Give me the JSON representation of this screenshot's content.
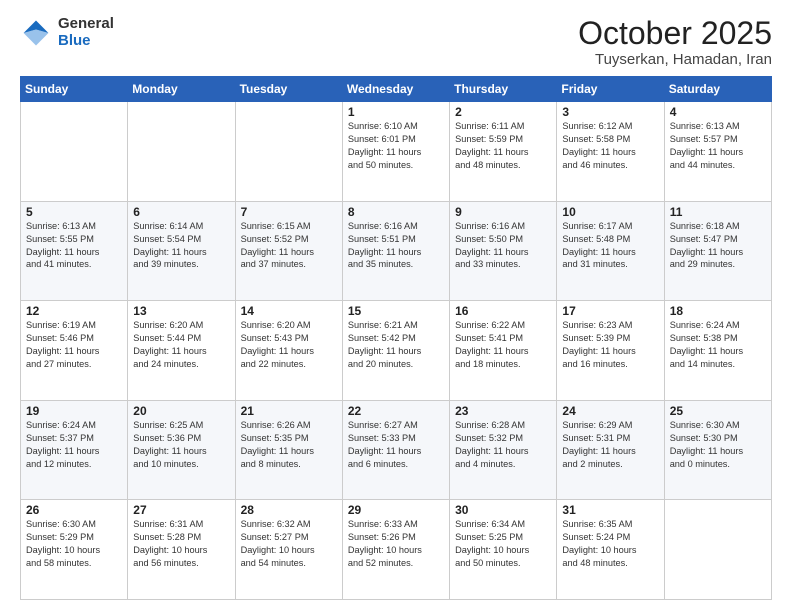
{
  "logo": {
    "general": "General",
    "blue": "Blue"
  },
  "header": {
    "month": "October 2025",
    "location": "Tuyserkan, Hamadan, Iran"
  },
  "weekdays": [
    "Sunday",
    "Monday",
    "Tuesday",
    "Wednesday",
    "Thursday",
    "Friday",
    "Saturday"
  ],
  "weeks": [
    [
      {
        "day": "",
        "info": ""
      },
      {
        "day": "",
        "info": ""
      },
      {
        "day": "",
        "info": ""
      },
      {
        "day": "1",
        "info": "Sunrise: 6:10 AM\nSunset: 6:01 PM\nDaylight: 11 hours\nand 50 minutes."
      },
      {
        "day": "2",
        "info": "Sunrise: 6:11 AM\nSunset: 5:59 PM\nDaylight: 11 hours\nand 48 minutes."
      },
      {
        "day": "3",
        "info": "Sunrise: 6:12 AM\nSunset: 5:58 PM\nDaylight: 11 hours\nand 46 minutes."
      },
      {
        "day": "4",
        "info": "Sunrise: 6:13 AM\nSunset: 5:57 PM\nDaylight: 11 hours\nand 44 minutes."
      }
    ],
    [
      {
        "day": "5",
        "info": "Sunrise: 6:13 AM\nSunset: 5:55 PM\nDaylight: 11 hours\nand 41 minutes."
      },
      {
        "day": "6",
        "info": "Sunrise: 6:14 AM\nSunset: 5:54 PM\nDaylight: 11 hours\nand 39 minutes."
      },
      {
        "day": "7",
        "info": "Sunrise: 6:15 AM\nSunset: 5:52 PM\nDaylight: 11 hours\nand 37 minutes."
      },
      {
        "day": "8",
        "info": "Sunrise: 6:16 AM\nSunset: 5:51 PM\nDaylight: 11 hours\nand 35 minutes."
      },
      {
        "day": "9",
        "info": "Sunrise: 6:16 AM\nSunset: 5:50 PM\nDaylight: 11 hours\nand 33 minutes."
      },
      {
        "day": "10",
        "info": "Sunrise: 6:17 AM\nSunset: 5:48 PM\nDaylight: 11 hours\nand 31 minutes."
      },
      {
        "day": "11",
        "info": "Sunrise: 6:18 AM\nSunset: 5:47 PM\nDaylight: 11 hours\nand 29 minutes."
      }
    ],
    [
      {
        "day": "12",
        "info": "Sunrise: 6:19 AM\nSunset: 5:46 PM\nDaylight: 11 hours\nand 27 minutes."
      },
      {
        "day": "13",
        "info": "Sunrise: 6:20 AM\nSunset: 5:44 PM\nDaylight: 11 hours\nand 24 minutes."
      },
      {
        "day": "14",
        "info": "Sunrise: 6:20 AM\nSunset: 5:43 PM\nDaylight: 11 hours\nand 22 minutes."
      },
      {
        "day": "15",
        "info": "Sunrise: 6:21 AM\nSunset: 5:42 PM\nDaylight: 11 hours\nand 20 minutes."
      },
      {
        "day": "16",
        "info": "Sunrise: 6:22 AM\nSunset: 5:41 PM\nDaylight: 11 hours\nand 18 minutes."
      },
      {
        "day": "17",
        "info": "Sunrise: 6:23 AM\nSunset: 5:39 PM\nDaylight: 11 hours\nand 16 minutes."
      },
      {
        "day": "18",
        "info": "Sunrise: 6:24 AM\nSunset: 5:38 PM\nDaylight: 11 hours\nand 14 minutes."
      }
    ],
    [
      {
        "day": "19",
        "info": "Sunrise: 6:24 AM\nSunset: 5:37 PM\nDaylight: 11 hours\nand 12 minutes."
      },
      {
        "day": "20",
        "info": "Sunrise: 6:25 AM\nSunset: 5:36 PM\nDaylight: 11 hours\nand 10 minutes."
      },
      {
        "day": "21",
        "info": "Sunrise: 6:26 AM\nSunset: 5:35 PM\nDaylight: 11 hours\nand 8 minutes."
      },
      {
        "day": "22",
        "info": "Sunrise: 6:27 AM\nSunset: 5:33 PM\nDaylight: 11 hours\nand 6 minutes."
      },
      {
        "day": "23",
        "info": "Sunrise: 6:28 AM\nSunset: 5:32 PM\nDaylight: 11 hours\nand 4 minutes."
      },
      {
        "day": "24",
        "info": "Sunrise: 6:29 AM\nSunset: 5:31 PM\nDaylight: 11 hours\nand 2 minutes."
      },
      {
        "day": "25",
        "info": "Sunrise: 6:30 AM\nSunset: 5:30 PM\nDaylight: 11 hours\nand 0 minutes."
      }
    ],
    [
      {
        "day": "26",
        "info": "Sunrise: 6:30 AM\nSunset: 5:29 PM\nDaylight: 10 hours\nand 58 minutes."
      },
      {
        "day": "27",
        "info": "Sunrise: 6:31 AM\nSunset: 5:28 PM\nDaylight: 10 hours\nand 56 minutes."
      },
      {
        "day": "28",
        "info": "Sunrise: 6:32 AM\nSunset: 5:27 PM\nDaylight: 10 hours\nand 54 minutes."
      },
      {
        "day": "29",
        "info": "Sunrise: 6:33 AM\nSunset: 5:26 PM\nDaylight: 10 hours\nand 52 minutes."
      },
      {
        "day": "30",
        "info": "Sunrise: 6:34 AM\nSunset: 5:25 PM\nDaylight: 10 hours\nand 50 minutes."
      },
      {
        "day": "31",
        "info": "Sunrise: 6:35 AM\nSunset: 5:24 PM\nDaylight: 10 hours\nand 48 minutes."
      },
      {
        "day": "",
        "info": ""
      }
    ]
  ]
}
